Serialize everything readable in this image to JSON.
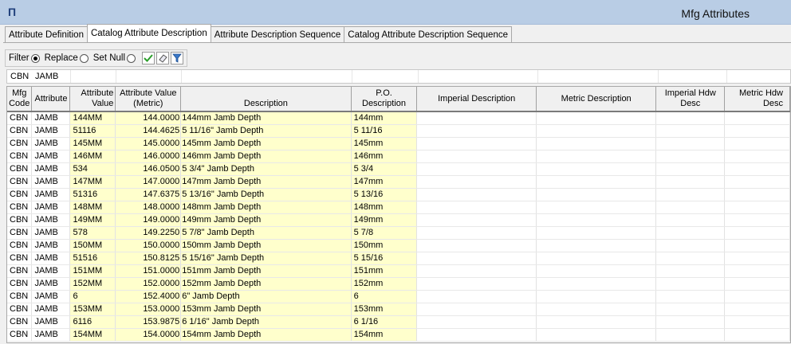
{
  "window": {
    "title": "Mfg Attributes"
  },
  "tabs": [
    {
      "label": "Attribute Definition"
    },
    {
      "label": "Catalog Attribute Description"
    },
    {
      "label": "Attribute Description Sequence"
    },
    {
      "label": "Catalog Attribute Description Sequence"
    }
  ],
  "toolbar": {
    "filter_label": "Filter",
    "replace_label": "Replace",
    "setnull_label": "Set Null",
    "selected_mode": "Filter"
  },
  "filter_row": {
    "mfg_code": "CBN",
    "attribute": "JAMB"
  },
  "grid": {
    "columns": [
      {
        "label": "Mfg Code"
      },
      {
        "label": "Attribute"
      },
      {
        "label": "Attribute Value"
      },
      {
        "label": "Attribute Value (Metric)"
      },
      {
        "label": "Description"
      },
      {
        "label": "P.O. Description"
      },
      {
        "label": "Imperial Description"
      },
      {
        "label": "Metric Description"
      },
      {
        "label": "Imperial Hdw Desc"
      },
      {
        "label": "Metric Hdw Desc"
      }
    ],
    "rows": [
      [
        "CBN",
        "JAMB",
        "144MM",
        "144.0000",
        "144mm Jamb Depth",
        "144mm",
        "",
        "",
        "",
        ""
      ],
      [
        "CBN",
        "JAMB",
        "51116",
        "144.4625",
        "5 11/16\" Jamb Depth",
        "5 11/16",
        "",
        "",
        "",
        ""
      ],
      [
        "CBN",
        "JAMB",
        "145MM",
        "145.0000",
        "145mm Jamb Depth",
        "145mm",
        "",
        "",
        "",
        ""
      ],
      [
        "CBN",
        "JAMB",
        "146MM",
        "146.0000",
        "146mm Jamb Depth",
        "146mm",
        "",
        "",
        "",
        ""
      ],
      [
        "CBN",
        "JAMB",
        "534",
        "146.0500",
        "5 3/4\" Jamb Depth",
        "5 3/4",
        "",
        "",
        "",
        ""
      ],
      [
        "CBN",
        "JAMB",
        "147MM",
        "147.0000",
        "147mm Jamb Depth",
        "147mm",
        "",
        "",
        "",
        ""
      ],
      [
        "CBN",
        "JAMB",
        "51316",
        "147.6375",
        "5 13/16\" Jamb Depth",
        "5 13/16",
        "",
        "",
        "",
        ""
      ],
      [
        "CBN",
        "JAMB",
        "148MM",
        "148.0000",
        "148mm Jamb Depth",
        "148mm",
        "",
        "",
        "",
        ""
      ],
      [
        "CBN",
        "JAMB",
        "149MM",
        "149.0000",
        "149mm Jamb Depth",
        "149mm",
        "",
        "",
        "",
        ""
      ],
      [
        "CBN",
        "JAMB",
        "578",
        "149.2250",
        "5 7/8\" Jamb Depth",
        "5 7/8",
        "",
        "",
        "",
        ""
      ],
      [
        "CBN",
        "JAMB",
        "150MM",
        "150.0000",
        "150mm Jamb Depth",
        "150mm",
        "",
        "",
        "",
        ""
      ],
      [
        "CBN",
        "JAMB",
        "51516",
        "150.8125",
        "5 15/16\" Jamb Depth",
        "5 15/16",
        "",
        "",
        "",
        ""
      ],
      [
        "CBN",
        "JAMB",
        "151MM",
        "151.0000",
        "151mm Jamb Depth",
        "151mm",
        "",
        "",
        "",
        ""
      ],
      [
        "CBN",
        "JAMB",
        "152MM",
        "152.0000",
        "152mm Jamb Depth",
        "152mm",
        "",
        "",
        "",
        ""
      ],
      [
        "CBN",
        "JAMB",
        "6",
        "152.4000",
        "6\" Jamb Depth",
        "6",
        "",
        "",
        "",
        ""
      ],
      [
        "CBN",
        "JAMB",
        "153MM",
        "153.0000",
        "153mm Jamb Depth",
        "153mm",
        "",
        "",
        "",
        ""
      ],
      [
        "CBN",
        "JAMB",
        "6116",
        "153.9875",
        "6 1/16\" Jamb Depth",
        "6 1/16",
        "",
        "",
        "",
        ""
      ],
      [
        "CBN",
        "JAMB",
        "154MM",
        "154.0000",
        "154mm Jamb Depth",
        "154mm",
        "",
        "",
        "",
        ""
      ]
    ]
  }
}
